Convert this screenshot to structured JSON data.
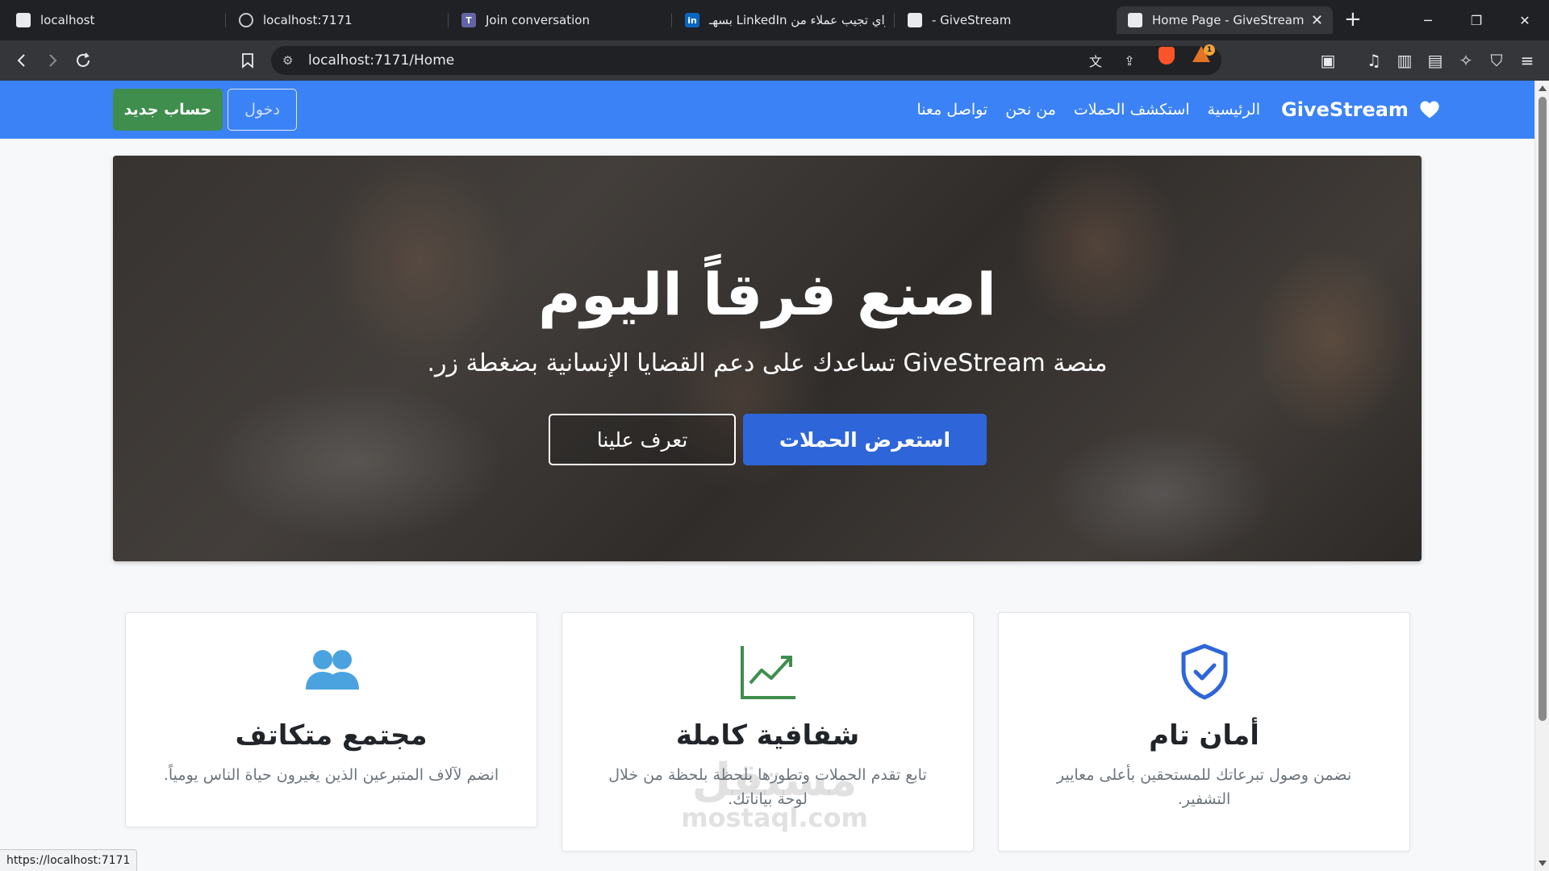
{
  "browser": {
    "tabs": [
      {
        "title": "localhost",
        "icon": "page-icon"
      },
      {
        "title": "localhost:7171",
        "icon": "circle-icon"
      },
      {
        "title": "Join conversation",
        "icon": "teams-icon"
      },
      {
        "title": "اراي تجيب عملاء من LinkedIn بسهـ",
        "icon": "linkedin-icon"
      },
      {
        "title": "- GiveStream",
        "icon": "page-icon"
      },
      {
        "title": "Home Page - GiveStream",
        "icon": "page-icon",
        "active": true
      }
    ],
    "new_tab": "+",
    "url": "localhost:7171/Home",
    "status_url": "https://localhost:7171"
  },
  "navbar": {
    "brand": "GiveStream",
    "links": [
      "الرئيسية",
      "استكشف الحملات",
      "من نحن",
      "تواصل معنا"
    ],
    "login_label": "دخول",
    "signup_label": "حساب جديد",
    "colors": {
      "bar": "#3b82f6",
      "signup": "#3f8e4d"
    }
  },
  "hero": {
    "title": "اصنع فرقاً اليوم",
    "subtitle": "منصة GiveStream تساعدك على دعم القضايا الإنسانية بضغطة زر.",
    "primary_button": "استعرض الحملات",
    "secondary_button": "تعرف علينا"
  },
  "features": [
    {
      "icon": "shield-check-icon",
      "title": "أمان تام",
      "text": "نضمن وصول تبرعاتك للمستحقين بأعلى معايير التشفير."
    },
    {
      "icon": "chart-line-icon",
      "title": "شفافية كاملة",
      "text": "تابع تقدم الحملات وتطورها بلحظة بلحظة من خلال لوحة بياناتك."
    },
    {
      "icon": "users-icon",
      "title": "مجتمع متكاتف",
      "text": "انضم لآلاف المتبرعين الذين يغيرون حياة الناس يومياً."
    }
  ],
  "watermark": {
    "line1": "مستقل",
    "line2": "mostaql.com"
  }
}
